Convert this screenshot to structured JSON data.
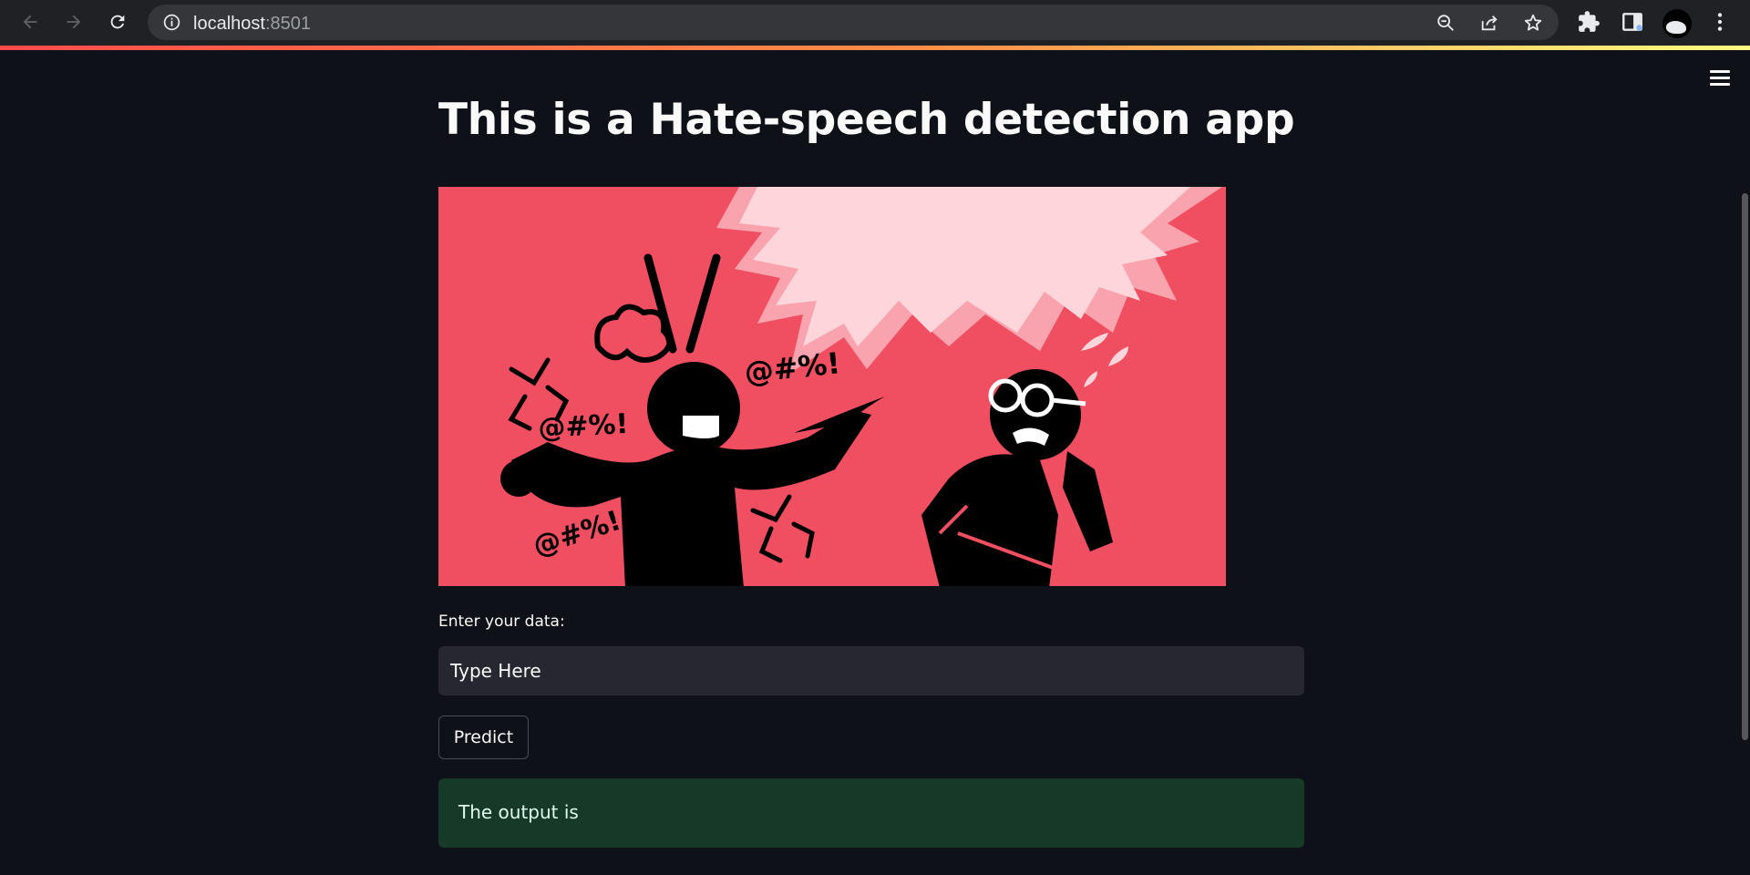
{
  "browser": {
    "url_host": "localhost",
    "url_port": ":8501",
    "icons": [
      "back-icon",
      "forward-icon",
      "reload-icon",
      "info-icon",
      "zoom-out-icon",
      "share-icon",
      "star-icon",
      "extensions-icon",
      "side-panel-icon",
      "profile-avatar",
      "more-menu-icon"
    ]
  },
  "app": {
    "title": "This is a Hate-speech detection app",
    "image_text": {
      "symbols_1": "@#%!",
      "symbols_2": "@#%!",
      "symbols_3": "@#%!"
    },
    "input_label": "Enter your data:",
    "input_placeholder": "Type Here",
    "input_value": "",
    "predict_label": "Predict",
    "output_text": "The output is"
  },
  "colors": {
    "background": "#0e1117",
    "image_background": "#ef4f61",
    "output_background": "#173928",
    "input_background": "#262730"
  }
}
